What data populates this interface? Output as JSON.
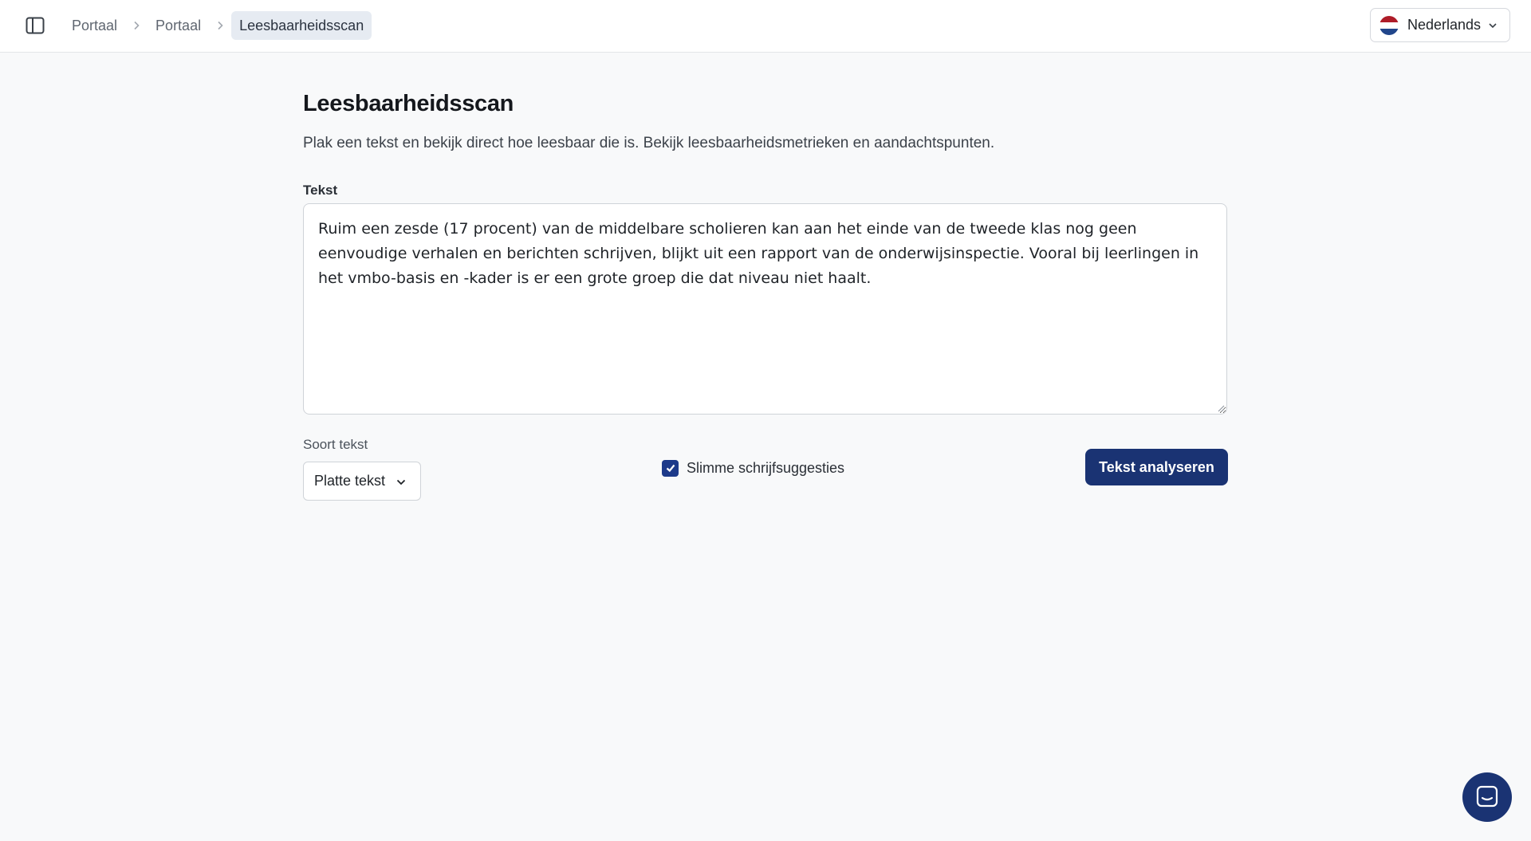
{
  "breadcrumb": {
    "items": [
      "Portaal",
      "Portaal"
    ],
    "current": "Leesbaarheidsscan"
  },
  "language": {
    "selected": "Nederlands",
    "flag_colors": [
      "#ae1c28",
      "#ffffff",
      "#21468b"
    ]
  },
  "main": {
    "title": "Leesbaarheidsscan",
    "description": "Plak een tekst en bekijk direct hoe leesbaar die is. Bekijk leesbaarheidsmetrieken en aandachtspunten.",
    "text_label": "Tekst",
    "text_value": "Ruim een zesde (17 procent) van de middelbare scholieren kan aan het einde van de tweede klas nog geen eenvoudige verhalen en berichten schrijven, blijkt uit een rapport van de onderwijsinspectie. Vooral bij leerlingen in het vmbo-basis en -kader is er een grote groep die dat niveau niet haalt.",
    "type_label": "Soort tekst",
    "type_selected": "Platte tekst",
    "smart_suggestions_label": "Slimme schrijfsuggesties",
    "smart_suggestions_checked": true,
    "analyze_button": "Tekst analyseren"
  },
  "colors": {
    "accent": "#1a3373",
    "background": "#f8f9fa"
  },
  "icons": {
    "sidebar_toggle": "sidebar-toggle-icon",
    "breadcrumb_separator": "chevron-right-icon",
    "dropdown": "chevron-down-icon",
    "checkbox": "checkmark-icon",
    "chat": "chat-icon"
  }
}
